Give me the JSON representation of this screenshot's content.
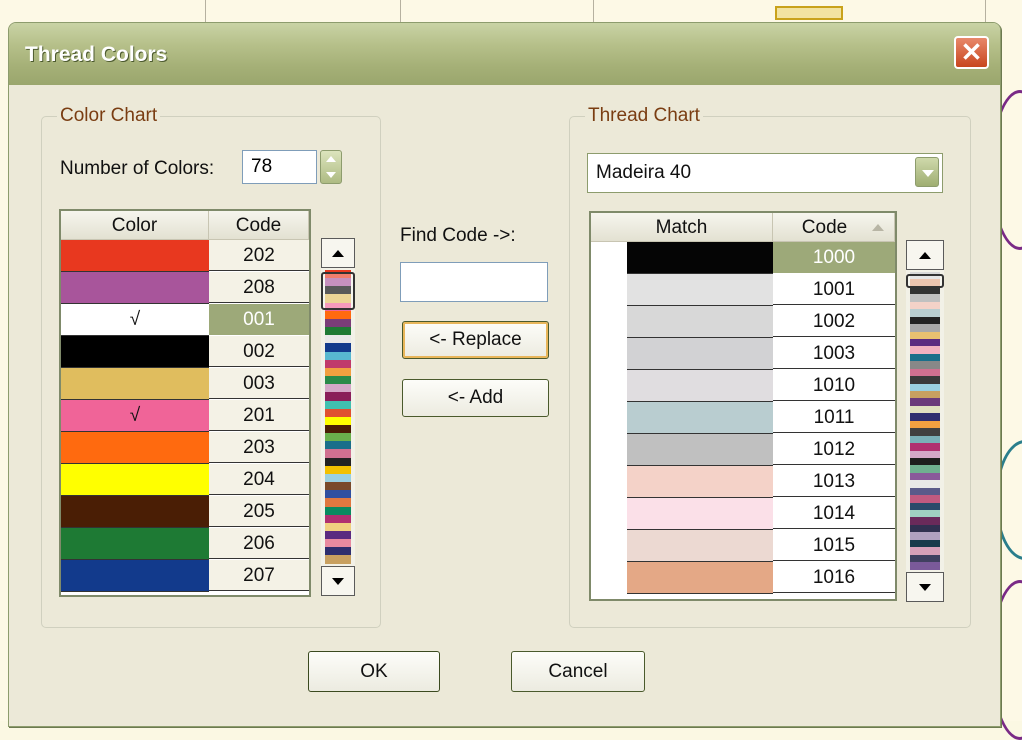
{
  "dialog": {
    "title": "Thread Colors",
    "close_symbol": "✕"
  },
  "color_chart": {
    "group_label": "Color Chart",
    "number_label": "Number of Colors:",
    "number_value": "78",
    "col_color": "Color",
    "col_code": "Code",
    "rows": [
      {
        "color": "#e8381f",
        "code": "202",
        "check": "",
        "selected": false
      },
      {
        "color": "#a8559b",
        "code": "208",
        "check": "",
        "selected": false
      },
      {
        "color": "#ffffff",
        "code": "001",
        "check": "√",
        "selected": true
      },
      {
        "color": "#000000",
        "code": "002",
        "check": "",
        "selected": false
      },
      {
        "color": "#e0bd5e",
        "code": "003",
        "check": "",
        "selected": false
      },
      {
        "color": "#f06498",
        "code": "201",
        "check": "√",
        "selected": false
      },
      {
        "color": "#ff6a0f",
        "code": "203",
        "check": "",
        "selected": false
      },
      {
        "color": "#ffff00",
        "code": "204",
        "check": "",
        "selected": false
      },
      {
        "color": "#4a1e05",
        "code": "205",
        "check": "",
        "selected": false
      },
      {
        "color": "#1e7a34",
        "code": "206",
        "check": "",
        "selected": false
      },
      {
        "color": "#123a8c",
        "code": "207",
        "check": "",
        "selected": false
      }
    ],
    "strip_colors": [
      "#e8381f",
      "#a8559b",
      "#000000",
      "#e0bd5e",
      "#f06498",
      "#ff6a0f",
      "#7a3d78",
      "#1e7a34",
      "#e8e8e8",
      "#123a8c",
      "#58b8d0",
      "#c03a6b",
      "#f2a040",
      "#2b8a4a",
      "#d4a8c8",
      "#8a1f5a",
      "#40c0b0",
      "#e05030",
      "#ffff00",
      "#4a1e05",
      "#6ab04c",
      "#1a6e8a",
      "#d07090",
      "#222222",
      "#f2c000",
      "#9ad0e0",
      "#7a4a2a",
      "#3050a0",
      "#e07840",
      "#0a8a60",
      "#b03070",
      "#f0d080",
      "#5a2a80",
      "#e88aa0",
      "#2e2e6e",
      "#c8a060"
    ]
  },
  "find": {
    "label": "Find Code ->:",
    "value": "",
    "replace_label": "<- Replace",
    "add_label": "<- Add"
  },
  "thread_chart": {
    "group_label": "Thread Chart",
    "brand": "Madeira 40",
    "col_match": "Match",
    "col_code": "Code",
    "rows": [
      {
        "color": "#050505",
        "code": "1000",
        "selected": true
      },
      {
        "color": "#e2e2e2",
        "code": "1001",
        "selected": false
      },
      {
        "color": "#d8d8d8",
        "code": "1002",
        "selected": false
      },
      {
        "color": "#d2d2d4",
        "code": "1003",
        "selected": false
      },
      {
        "color": "#e0dde0",
        "code": "1010",
        "selected": false
      },
      {
        "color": "#b9cdd0",
        "code": "1011",
        "selected": false
      },
      {
        "color": "#c0c0c0",
        "code": "1012",
        "selected": false
      },
      {
        "color": "#f4d2c8",
        "code": "1013",
        "selected": false
      },
      {
        "color": "#fbe0e8",
        "code": "1014",
        "selected": false
      },
      {
        "color": "#ecd9d2",
        "code": "1015",
        "selected": false
      },
      {
        "color": "#e4a886",
        "code": "1016",
        "selected": false
      }
    ],
    "strip_colors": [
      "#d8d8d8",
      "#e4a886",
      "#333333",
      "#c0c0c0",
      "#f4d2c8",
      "#b9cdd0",
      "#222222",
      "#a8a8a8",
      "#e8c070",
      "#5a2a80",
      "#f0b0c0",
      "#1a6e8a",
      "#888888",
      "#d07090",
      "#3a3a3a",
      "#9ad0e0",
      "#c8a060",
      "#6a3a7a",
      "#e0e0c0",
      "#2e2e6e",
      "#f2a040",
      "#404040",
      "#7ab0b8",
      "#b03070",
      "#d4a8c8",
      "#1e1e1e",
      "#70b090",
      "#8a5a9a",
      "#e8e8e8",
      "#5a5a8a",
      "#c05a80",
      "#2a4a6a",
      "#a0d0c0",
      "#6a2a5a",
      "#303050",
      "#b0a0c0",
      "#1a3a4a",
      "#d8a0b8",
      "#404060",
      "#7a5a9a"
    ]
  },
  "footer": {
    "ok_label": "OK",
    "cancel_label": "Cancel"
  }
}
